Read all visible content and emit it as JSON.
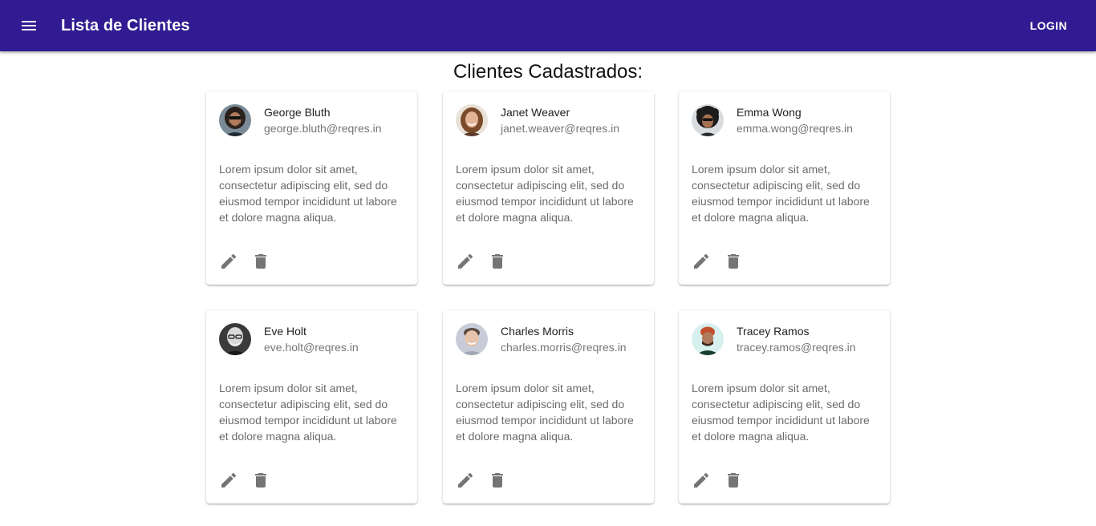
{
  "appbar": {
    "title": "Lista de Clientes",
    "login_label": "LOGIN",
    "background": "#311b92"
  },
  "main": {
    "title": "Clientes Cadastrados:"
  },
  "clients": [
    {
      "name": "George Bluth",
      "email": "george.bluth@reqres.in",
      "description": "Lorem ipsum dolor sit amet, consectetur adipiscing elit, sed do eiusmod tempor incididunt ut labore et dolore magna aliqua."
    },
    {
      "name": "Janet Weaver",
      "email": "janet.weaver@reqres.in",
      "description": "Lorem ipsum dolor sit amet, consectetur adipiscing elit, sed do eiusmod tempor incididunt ut labore et dolore magna aliqua."
    },
    {
      "name": "Emma Wong",
      "email": "emma.wong@reqres.in",
      "description": "Lorem ipsum dolor sit amet, consectetur adipiscing elit, sed do eiusmod tempor incididunt ut labore et dolore magna aliqua."
    },
    {
      "name": "Eve Holt",
      "email": "eve.holt@reqres.in",
      "description": "Lorem ipsum dolor sit amet, consectetur adipiscing elit, sed do eiusmod tempor incididunt ut labore et dolore magna aliqua."
    },
    {
      "name": "Charles Morris",
      "email": "charles.morris@reqres.in",
      "description": "Lorem ipsum dolor sit amet, consectetur adipiscing elit, sed do eiusmod tempor incididunt ut labore et dolore magna aliqua."
    },
    {
      "name": "Tracey Ramos",
      "email": "tracey.ramos@reqres.in",
      "description": "Lorem ipsum dolor sit amet, consectetur adipiscing elit, sed do eiusmod tempor incididunt ut labore et dolore magna aliqua."
    }
  ],
  "icons": {
    "menu": "menu-icon",
    "edit": "pencil-icon",
    "delete": "trash-icon"
  }
}
